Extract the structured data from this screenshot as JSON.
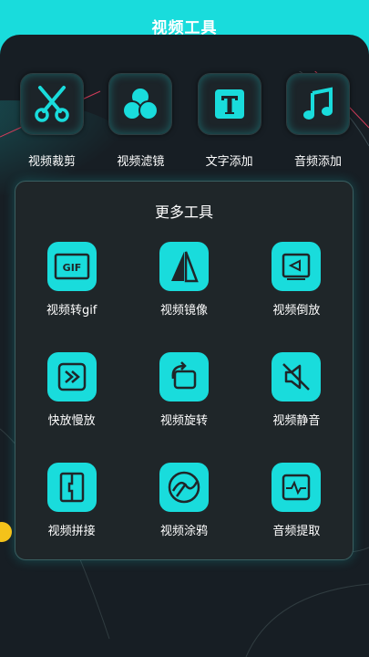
{
  "header": {
    "title": "视频工具"
  },
  "top_tools": [
    {
      "label": "视频裁剪",
      "icon": "scissors-icon"
    },
    {
      "label": "视频滤镜",
      "icon": "filter-circles-icon"
    },
    {
      "label": "文字添加",
      "icon": "text-T-icon"
    },
    {
      "label": "音频添加",
      "icon": "music-note-icon"
    }
  ],
  "more": {
    "title": "更多工具",
    "tools": [
      {
        "label": "视频转gif",
        "icon": "gif-icon"
      },
      {
        "label": "视频镜像",
        "icon": "mirror-icon"
      },
      {
        "label": "视频倒放",
        "icon": "reverse-icon"
      },
      {
        "label": "快放慢放",
        "icon": "speed-icon"
      },
      {
        "label": "视频旋转",
        "icon": "rotate-icon"
      },
      {
        "label": "视频静音",
        "icon": "mute-icon"
      },
      {
        "label": "视频拼接",
        "icon": "splice-icon"
      },
      {
        "label": "视频涂鸦",
        "icon": "doodle-icon"
      },
      {
        "label": "音频提取",
        "icon": "audio-extract-icon"
      }
    ]
  },
  "colors": {
    "accent": "#19dcdc",
    "background": "#171e24",
    "panel": "#1f2629",
    "dot": "#f4c21a"
  }
}
